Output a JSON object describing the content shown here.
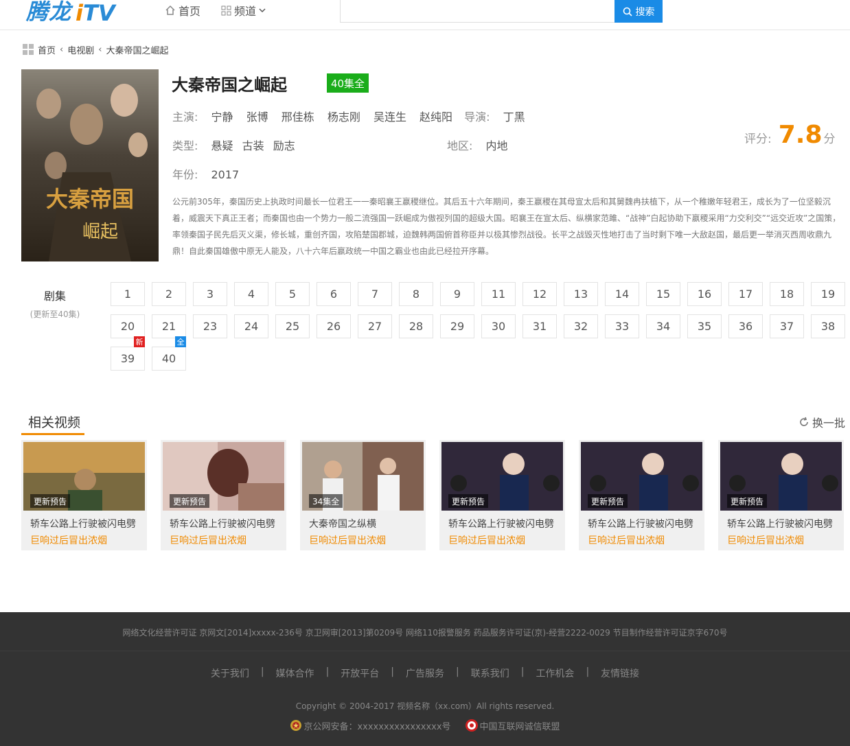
{
  "header": {
    "logo_cn": "腾龙",
    "logo_i": "i",
    "logo_tv": "TV",
    "nav_home": "首页",
    "nav_channels": "频道",
    "search_placeholder": "",
    "search_button": "搜索"
  },
  "breadcrumb": {
    "home": "首页",
    "category": "电视剧",
    "current": "大秦帝国之崛起"
  },
  "show": {
    "title": "大秦帝国之崛起",
    "episode_badge": "40集全",
    "cast_label": "主演:",
    "cast": [
      "宁静",
      "张博",
      "邢佳栋",
      "杨志刚",
      "吴连生",
      "赵纯阳"
    ],
    "director_label": "导演:",
    "director": "丁黑",
    "genre_label": "类型:",
    "genres": [
      "悬疑",
      "古装",
      "励志"
    ],
    "region_label": "地区:",
    "region": "内地",
    "year_label": "年份:",
    "year": "2017",
    "rating_label": "评分:",
    "rating": "7.8",
    "rating_unit": "分",
    "description": "公元前305年，秦国历史上执政时间最长一位君王一一秦昭襄王嬴稷继位。其后五十六年期间，秦王嬴稷在其母宣太后和其舅魏冉扶植下，从一个稚嫩年轻君王，成长为了一位坚毅沉着，威震天下真正王者；而秦国也由一个势力一般二流强国一跃崛成为傲视列国的超级大国。昭襄王在宣太后、纵横家范雎、“战神”白起协助下嬴稷采用“力交利交”“远交近攻”之国策，率领秦国子民先后灭义渠，修长城，重创齐国，攻陷楚国郡城，迫魏韩两国俯首称臣并以极其惨烈战役。长平之战毁灭性地打击了当时剩下唯一大敌赵国，最后更一举消灭西周收鼎九鼎！自此秦国雄傲中原无人能及，八十六年后嬴政统一中国之霸业也由此已经拉开序幕。"
  },
  "episodes": {
    "label": "剧集",
    "sub": "(更新至40集)",
    "list": [
      "1",
      "2",
      "3",
      "4",
      "5",
      "6",
      "7",
      "8",
      "9",
      "11",
      "12",
      "13",
      "14",
      "15",
      "16",
      "17",
      "18",
      "19",
      "20",
      "21",
      "23",
      "24",
      "25",
      "26",
      "27",
      "28",
      "29",
      "30",
      "31",
      "32",
      "33",
      "34",
      "35",
      "36",
      "37",
      "38",
      "39",
      "40"
    ],
    "tag_new": "新",
    "tag_full": "全"
  },
  "related": {
    "title": "相关视频",
    "refresh": "换一批",
    "items": [
      {
        "tag": "更新预告",
        "line1": "轿车公路上行驶被闪电劈",
        "line2": "巨响过后冒出浓烟"
      },
      {
        "tag": "更新预告",
        "line1": "轿车公路上行驶被闪电劈",
        "line2": "巨响过后冒出浓烟"
      },
      {
        "tag": "34集全",
        "line1": "大秦帝国之纵横",
        "line2": "巨响过后冒出浓烟"
      },
      {
        "tag": "更新预告",
        "line1": "轿车公路上行驶被闪电劈",
        "line2": "巨响过后冒出浓烟"
      },
      {
        "tag": "更新预告",
        "line1": "轿车公路上行驶被闪电劈",
        "line2": "巨响过后冒出浓烟"
      },
      {
        "tag": "更新预告",
        "line1": "轿车公路上行驶被闪电劈",
        "line2": "巨响过后冒出浓烟"
      }
    ]
  },
  "footer": {
    "licenses": "网络文化经营许可证 京网文[2014]xxxxx-236号   京卫网审[2013]第0209号 网络110报警服务   药品服务许可证(京)-经营2222-0029   节目制作经营许可证京字670号",
    "links": [
      "关于我们",
      "媒体合作",
      "开放平台",
      "广告服务",
      "联系我们",
      "工作机会",
      "友情链接"
    ],
    "copyright": "Copyright © 2004-2017 视频名称（xx.com）All rights reserved.",
    "badge1": "京公网安备：xxxxxxxxxxxxxxxx号",
    "badge2": "中国互联网诚信联盟"
  },
  "colors": {
    "accent_orange": "#f08a00",
    "accent_blue": "#1a8be6",
    "badge_green": "#1aad1a",
    "footer_bg": "#333333"
  }
}
